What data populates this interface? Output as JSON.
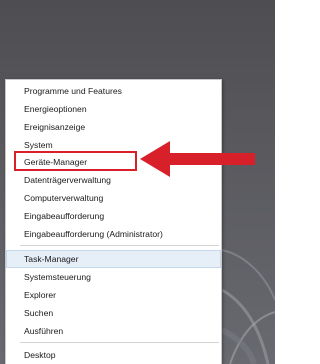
{
  "context_menu": {
    "items": [
      {
        "label": "Programme und Features"
      },
      {
        "label": "Energieoptionen"
      },
      {
        "label": "Ereignisanzeige"
      },
      {
        "label": "System"
      },
      {
        "label": "Geräte-Manager"
      },
      {
        "label": "Datenträgerverwaltung"
      },
      {
        "label": "Computerverwaltung"
      },
      {
        "label": "Eingabeaufforderung"
      },
      {
        "label": "Eingabeaufforderung (Administrator)"
      },
      {
        "label": "Task-Manager"
      },
      {
        "label": "Systemsteuerung"
      },
      {
        "label": "Explorer"
      },
      {
        "label": "Suchen"
      },
      {
        "label": "Ausführen"
      },
      {
        "label": "Desktop"
      }
    ],
    "highlighted_item": "Geräte-Manager",
    "hovered_item": "Task-Manager"
  },
  "colors": {
    "annotation_red": "#d8202a",
    "desktop_background": "#5d5d62",
    "menu_background": "#ffffff",
    "hover_background": "#e6eef8"
  },
  "annotation": {
    "type": "arrow",
    "pointing_to": "Geräte-Manager"
  }
}
